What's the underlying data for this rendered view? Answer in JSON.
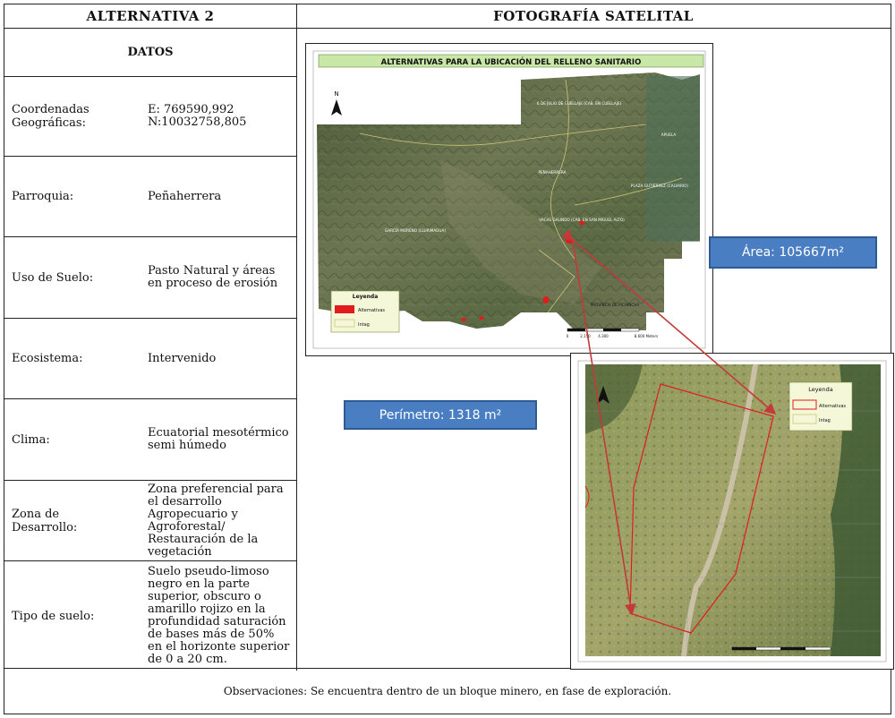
{
  "header": {
    "left_title": "ALTERNATIVA 2",
    "right_title": "FOTOGRAFÍA SATELITAL"
  },
  "datos_title": "DATOS",
  "rows": [
    {
      "label": "Coordenadas\nGeográficas:",
      "value": "E: 769590,992\nN:10032758,805"
    },
    {
      "label": "Parroquia:",
      "value": "Peñaherrera"
    },
    {
      "label": "Uso de Suelo:",
      "value": "Pasto Natural y áreas en proceso de erosión"
    },
    {
      "label": "Ecosistema:",
      "value": "Intervenido"
    },
    {
      "label": "Clima:",
      "value": "Ecuatorial mesotérmico semi húmedo"
    },
    {
      "label": "Zona de\nDesarrollo:",
      "value": "Zona preferencial para el desarrollo Agropecuario y Agroforestal/ Restauración de la vegetación"
    },
    {
      "label": "Tipo de suelo:",
      "value": "Suelo pseudo-limoso negro en la parte superior, obscuro o amarillo rojizo en la profundidad saturación de bases más de 50% en el horizonte superior de 0 a 20 cm."
    }
  ],
  "observaciones": "Observaciones: Se encuentra dentro de un bloque minero, en fase de exploración.",
  "map_main": {
    "title": "ALTERNATIVAS PARA LA UBICACIÓN DEL RELLENO SANITARIO",
    "north": "N",
    "places": {
      "p1": "6 DE JULIO DE CUELLAJE (CAB. EN CUELLAJE)",
      "p2": "APUELA",
      "p3": "PEÑAHERRERA",
      "p4": "PLAZA GUTIÉRREZ (CALVARIO)",
      "p5": "VACAS GALINDO (CAB. EN SAN MIGUEL ALTO)",
      "p6": "GARCÍA MORENO (LLURIMAGUA)",
      "p7": "PROVINCIA DE PICHINCHA"
    },
    "legend": {
      "title": "Leyenda",
      "items": [
        "Alternativas",
        "Intag"
      ]
    },
    "scale": [
      "0",
      "2.150",
      "4.300",
      "8.600 Meters"
    ]
  },
  "map_detail": {
    "legend": {
      "title": "Leyenda",
      "items": [
        "Alternativas",
        "Intag"
      ]
    }
  },
  "callouts": {
    "area": "Área: 105667m²",
    "perimetro": "Perímetro: 1318 m²"
  },
  "colors": {
    "callout_bg": "#4a7ec2",
    "alternative_red": "#e21c1c",
    "title_green": "#c9e7a6"
  }
}
